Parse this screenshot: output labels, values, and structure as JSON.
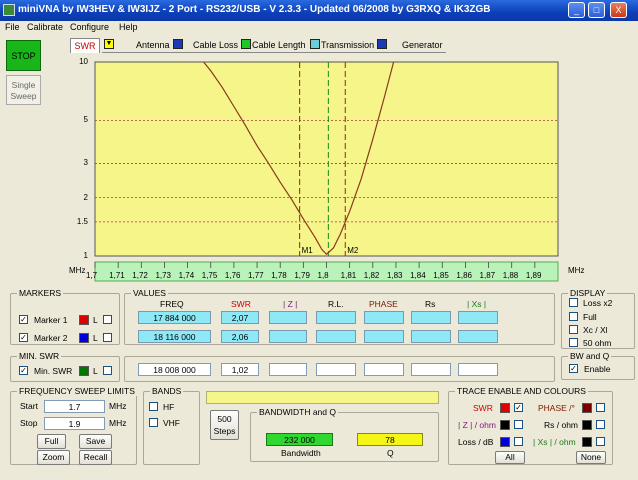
{
  "window": {
    "title": "miniVNA by IW3HEV & IW3IJZ - 2 Port - RS232/USB - V 2.3.3 - Updated 06/2008 by G3RXQ & IK3ZGB",
    "buttons": [
      "_",
      "□",
      "X"
    ]
  },
  "menu": [
    "File",
    "Calibrate",
    "Configure",
    "Help"
  ],
  "left": {
    "stop": "STOP",
    "single": "Single",
    "sweep": "Sweep"
  },
  "tabs": {
    "swr": "SWR",
    "antenna": "Antenna",
    "cable_loss": "Cable Loss",
    "cable_length": "Cable Length",
    "transmission": "Transmission",
    "generator": "Generator"
  },
  "axis": {
    "unit_left": "MHz",
    "unit_right": "MHz"
  },
  "chart_data": {
    "type": "line",
    "title": "",
    "xlabel": "MHz",
    "ylabel": "",
    "xlim": [
      1.7,
      1.9
    ],
    "ylim": [
      1,
      10
    ],
    "y_scale": "log",
    "x_ticks": [
      "1,7",
      "1,71",
      "1,72",
      "1,73",
      "1,74",
      "1,75",
      "1,76",
      "1,77",
      "1,78",
      "1,79",
      "1,8",
      "1,81",
      "1,82",
      "1,83",
      "1,84",
      "1,85",
      "1,86",
      "1,87",
      "1,88",
      "1,89"
    ],
    "y_ticks": [
      "10",
      "5",
      "3",
      "2",
      "1.5",
      "1"
    ],
    "series": [
      {
        "x": [
          1.7469,
          1.75,
          1.755,
          1.76,
          1.765,
          1.77,
          1.775,
          1.78,
          1.785,
          1.79,
          1.795,
          1.798,
          1.8,
          1.803,
          1.806,
          1.81,
          1.815,
          1.82,
          1.825,
          1.829
        ],
        "values": [
          10,
          9.0,
          7.4,
          5.9,
          4.7,
          3.7,
          3.0,
          2.4,
          1.95,
          1.55,
          1.25,
          1.08,
          1.02,
          1.1,
          1.3,
          1.7,
          2.5,
          4.0,
          6.6,
          10
        ]
      }
    ],
    "markers": [
      {
        "label": "M1",
        "x": 1.7884
      },
      {
        "label": "M2",
        "x": 1.8081
      }
    ],
    "min_marker_x": 1.8008,
    "grid": true
  },
  "markers_panel": {
    "legend": "MARKERS",
    "m1": "Marker 1",
    "m2": "Marker 2",
    "l": "L",
    "m1_check": "✓",
    "m2_check": "✓",
    "m1_color": "#dd0000",
    "m2_color": "#0000dd"
  },
  "values": {
    "legend": "VALUES",
    "headers": {
      "freq": "FREQ",
      "swr": "SWR",
      "z": "| Z |",
      "rl": "R.L.",
      "phase": "PHASE",
      "rs": "Rs",
      "xs": "| Xs |"
    },
    "m1": {
      "freq": "17 884 000",
      "swr": "2,07"
    },
    "m2": {
      "freq": "18 116 000",
      "swr": "2,06"
    },
    "min": {
      "freq": "18 008 000",
      "swr": "1,02"
    }
  },
  "display": {
    "legend": "DISPLAY",
    "items": [
      "Loss x2",
      "Full",
      "Xc / Xl",
      "50 ohm"
    ]
  },
  "minswr": {
    "legend": "MIN. SWR",
    "label": "Min. SWR",
    "l": "L",
    "check": "✓",
    "color": "#007700"
  },
  "bwq": {
    "legend": "BW and Q",
    "enable": "Enable",
    "check": "✓"
  },
  "sweep": {
    "legend": "FREQUENCY SWEEP LIMITS",
    "start_label": "Start",
    "start": "1.7",
    "stop_label": "Stop",
    "stop": "1.9",
    "unit": "MHz",
    "full": "Full",
    "save": "Save",
    "zoom": "Zoom",
    "recall": "Recall"
  },
  "bands": {
    "legend": "BANDS",
    "hf": "HF",
    "vhf": "VHF"
  },
  "steps": {
    "value": "500",
    "label": "Steps"
  },
  "bandwidth": {
    "legend": "BANDWIDTH and Q",
    "bw": "232 000",
    "q": "78",
    "bw_label": "Bandwidth",
    "q_label": "Q"
  },
  "trace": {
    "legend": "TRACE ENABLE AND COLOURS",
    "swr": "SWR",
    "swr_check": "✓",
    "phase": "PHASE /°",
    "z": "| Z | / ohm",
    "rs": "Rs / ohm",
    "loss": "Loss / dB",
    "xs": "| Xs | / ohm",
    "all": "All",
    "none": "None",
    "colors": {
      "swr": "#dd0000",
      "phase": "#7a0000",
      "z": "#000000",
      "rs": "#000000",
      "loss": "#0000dd",
      "xs": "#000000"
    }
  }
}
